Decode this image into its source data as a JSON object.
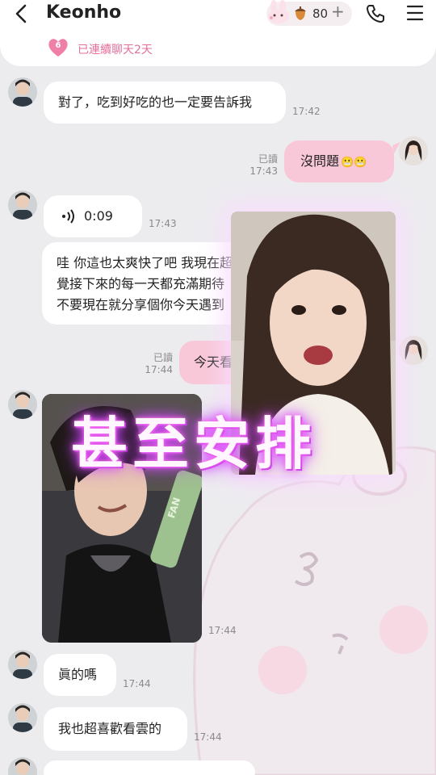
{
  "header": {
    "title": "Keonho",
    "acorn_count": "80",
    "plus": "+",
    "streak_badge": "6",
    "streak_text": "已連續聊天2天"
  },
  "messages": {
    "m1": {
      "text": "對了，吃到好吃的也一定要告訴我",
      "time": "17:42"
    },
    "m2": {
      "text": "沒問題",
      "emoji": "😬😬",
      "read": "已讀",
      "time": "17:43"
    },
    "m3": {
      "duration": "0:09",
      "time": "17:43"
    },
    "m4": {
      "line1": "哇 你這也太爽快了吧 我現在超",
      "line2": "覺接下來的每一天都充滿期待",
      "line3": "不要現在就分享個你今天遇到"
    },
    "m5": {
      "text": "今天看",
      "read": "已讀",
      "time": "17:44"
    },
    "m6": {
      "time": "17:44",
      "photo_text": "FAN"
    },
    "m7": {
      "text": "眞的嗎",
      "time": "17:44"
    },
    "m8": {
      "text": "我也超喜歡看雲的",
      "time": "17:44"
    }
  },
  "overlay": {
    "caption": "甚至安排"
  },
  "colors": {
    "accent": "#e46f9c",
    "outgoing": "#f8c8d8",
    "incoming": "#ffffff",
    "background": "#ececef"
  }
}
